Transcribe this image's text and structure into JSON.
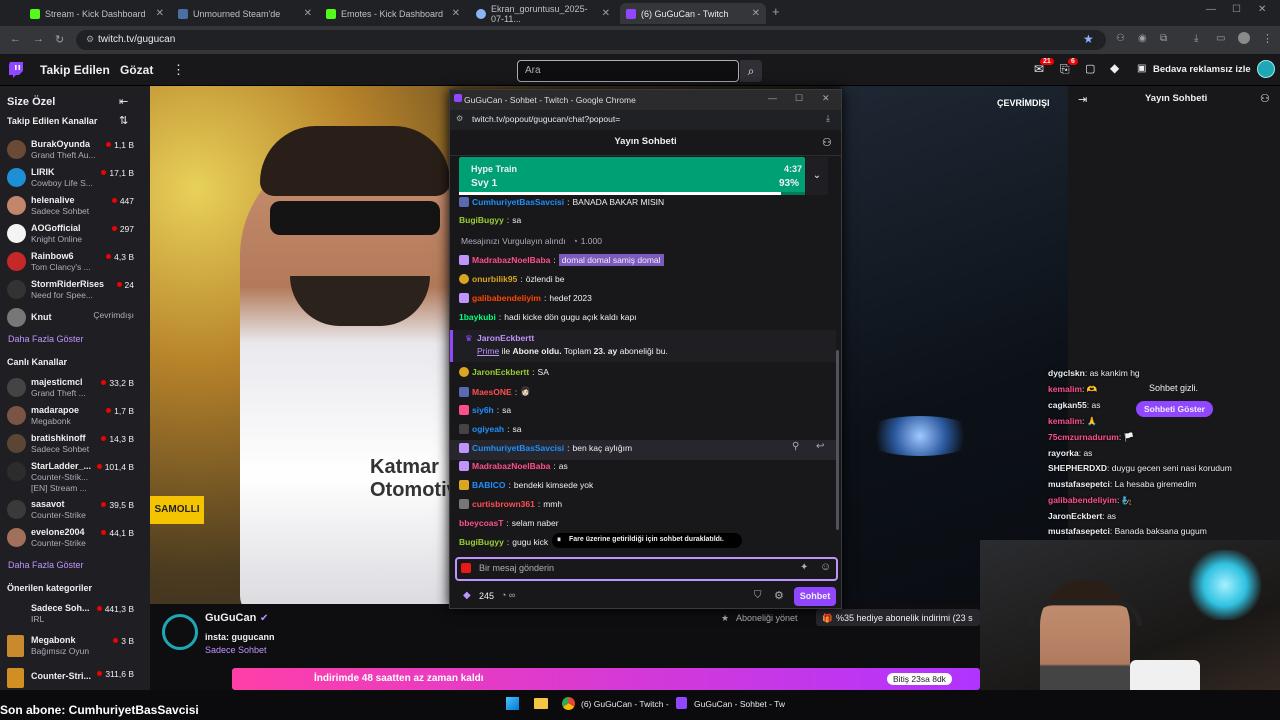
{
  "browser": {
    "tabs": [
      {
        "label": "Stream - Kick Dashboard",
        "fav": "#53fc18"
      },
      {
        "label": "Unmourned Steam'de",
        "fav": "#1b2838"
      },
      {
        "label": "Emotes - Kick Dashboard",
        "fav": "#53fc18"
      },
      {
        "label": "Ekran_goruntusu_2025-07-11...",
        "fav": "#8ab4f8"
      },
      {
        "label": "(6) GuGuCan - Twitch",
        "fav": "#9147ff"
      }
    ],
    "url": "twitch.tv/gugucan"
  },
  "nav": {
    "following": "Takip Edilen",
    "browse": "Gözat",
    "search_placeholder": "Ara",
    "notif_count": "21",
    "inbox_count": "6",
    "ad_free": "Bedava reklamsız izle"
  },
  "sidebar": {
    "title": "Size Özel",
    "followed_header": "Takip Edilen Kanallar",
    "followed": [
      {
        "name": "BurakOyunda",
        "game": "Grand Theft Au...",
        "viewers": "1,1 B",
        "color": "#6b4a35"
      },
      {
        "name": "LIRIK",
        "game": "Cowboy Life S...",
        "viewers": "17,1 B",
        "color": "#1d8fd6"
      },
      {
        "name": "helenalive",
        "game": "Sadece Sohbet",
        "viewers": "447",
        "color": "#c2866a"
      },
      {
        "name": "AOGofficial",
        "game": "Knight Online",
        "viewers": "297",
        "color": "#f4f4f4"
      },
      {
        "name": "Rainbow6",
        "game": "Tom Clancy's ...",
        "viewers": "4,3 B",
        "color": "#c62828"
      },
      {
        "name": "StormRiderRises",
        "game": "Need for Spee...",
        "viewers": "24",
        "color": "#333"
      },
      {
        "name": "Knut",
        "game": "",
        "viewers": "",
        "offline": "Çevrimdışı",
        "color": "#777"
      }
    ],
    "show_more": "Daha Fazla Göster",
    "live_header": "Canlı Kanallar",
    "live": [
      {
        "name": "majesticmcl",
        "game": "Grand Theft ...",
        "viewers": "33,2 B",
        "color": "#444"
      },
      {
        "name": "madarapoe",
        "game": "Megabonk",
        "viewers": "1,7 B",
        "color": "#7b5544"
      },
      {
        "name": "bratishkinoff",
        "game": "Sadece Sohbet",
        "viewers": "14,3 B",
        "color": "#5b4636"
      },
      {
        "name": "StarLadder_...",
        "game": "Counter-Strik...",
        "game2": "[EN] Stream ...",
        "viewers": "101,4 B",
        "color": "#2c2c2c"
      },
      {
        "name": "sasavot",
        "game": "Counter-Strike",
        "viewers": "39,5 B",
        "color": "#3a3a3a"
      },
      {
        "name": "evelone2004",
        "game": "Counter-Strike",
        "viewers": "44,1 B",
        "color": "#a0705a"
      }
    ],
    "show_more2": "Daha Fazla Göster",
    "cat_header": "Önerilen kategoriler",
    "categories": [
      {
        "name": "Sadece Soh...",
        "game": "IRL",
        "viewers": "441,3 B",
        "color": "#5a6ab0"
      },
      {
        "name": "Megabonk",
        "game": "Bağımsız Oyun",
        "viewers": "3 B",
        "color": "#c98a2e"
      },
      {
        "name": "Counter-Stri...",
        "game": "",
        "viewers": "311,6 B",
        "color": "#d18e22"
      }
    ]
  },
  "stream": {
    "offline_label": "ÇEVRİMDIŞI",
    "channel": "GuGuCan",
    "insta": "insta: gugucann",
    "category": "Sadece Sohbet",
    "manage_subs": "Aboneliği yönet",
    "sub_discount": "%35 hediye abonelik indirimi (23 s",
    "banner": "İndirimde 48 saatten az zaman kaldı",
    "banner_right": "Bitiş 23sa 8dk",
    "last_sub": "Son abone: CumhuriyetBasSavcisi"
  },
  "popup": {
    "window_title": "GuGuCan - Sohbet - Twitch - Google Chrome",
    "url": "twitch.tv/popout/gugucan/chat?popout=",
    "header": "Yayın Sohbeti",
    "hype_title": "Hype Train",
    "hype_level": "Svy 1",
    "hype_time": "4:37",
    "hype_pct": "93%",
    "hype_progress": 0.93,
    "messages": [
      {
        "user": "CumhuriyetBasSavcisi",
        "color": "#1e90ff",
        "text": "BANADA BAKAR MISIN",
        "badge": "#5a6ab0"
      },
      {
        "user": "BugiBugyy",
        "color": "#9acd32",
        "text": "sa"
      },
      {
        "system": "Mesajınızı Vurgulayın alındı",
        "amount": "1.000"
      },
      {
        "user": "MadrabazNoelBaba",
        "color": "#ff4f8b",
        "text": "domal domal samiş domal",
        "badge": "#bf94ff",
        "highlight": true
      },
      {
        "user": "onurbilik95",
        "color": "#daa520",
        "text": "özlendi be",
        "badge": "#daa520"
      },
      {
        "user": "galibabendeliyim",
        "color": "#ff4500",
        "text": "hedef 2023",
        "badge": "#bf94ff"
      },
      {
        "user": "1baykubi",
        "color": "#00ff7f",
        "text": "hadi kicke dön gugu açık kaldı kapı"
      },
      {
        "sub_user": "JaronEckbertt",
        "sub_line1": "Prime",
        "sub_line2": "ile",
        "sub_bold": "Abone oldu.",
        "sub_rest": "Toplam",
        "sub_months": "23. ay",
        "sub_tail": "aboneliği bu."
      },
      {
        "user": "JaronEckbertt",
        "color": "#9acd32",
        "text": "SA",
        "badge": "#daa520"
      },
      {
        "user": "MaesONE",
        "color": "#ff4f4f",
        "text": "👩🏻",
        "badge": "#5a6ab0"
      },
      {
        "user": "siy6h",
        "color": "#1e90ff",
        "text": "sa",
        "badge": "#ff4f8b"
      },
      {
        "user": "ogiyeah",
        "color": "#1e90ff",
        "text": "sa",
        "badge": "#444"
      },
      {
        "user": "CumhuriyetBasSavcisi",
        "color": "#1e90ff",
        "text": "ben kaç aylığım",
        "badge": "#bf94ff"
      },
      {
        "user": "MadrabazNoelBaba",
        "color": "#ff4f8b",
        "text": "as",
        "badge": "#bf94ff"
      },
      {
        "user": "BABICO",
        "color": "#1e90ff",
        "text": "bendeki kimsede yok",
        "badge": "#daa520"
      },
      {
        "user": "curtisbrown361",
        "color": "#ff4f4f",
        "text": "mmh",
        "badge": "#777"
      },
      {
        "user": "bbeycoasT",
        "color": "#ff4f8b",
        "text": "selam naber"
      },
      {
        "user": "BugiBugyy",
        "color": "#9acd32",
        "text": "gugu kick"
      }
    ],
    "paused": "Fare üzerine getirildiği için sohbet duraklatıldı.",
    "input_placeholder": "Bir mesaj gönderin",
    "points": "245",
    "chat_button": "Sohbet"
  },
  "right_chat": {
    "header": "Yayın Sohbeti",
    "hidden": "Sohbet gizli.",
    "show_button": "Sohbeti Göster",
    "messages": [
      {
        "user": "dygclskn",
        "text": ": as kankim hg",
        "color": "#efeff1"
      },
      {
        "user": "kemalim",
        "text": ": 🫶",
        "color": "#ff4f8b"
      },
      {
        "user": "cagkan55",
        "text": ": as",
        "color": "#efeff1"
      },
      {
        "user": "kemalim",
        "text": ": 🙏",
        "color": "#ff4f8b"
      },
      {
        "user": "75cmzurnadurum",
        "text": ": 🏳️",
        "color": "#ff4f8b"
      },
      {
        "user": "rayorka",
        "text": ": as",
        "color": "#efeff1"
      },
      {
        "user": "SHEPHERDXD",
        "text": ": duygu gecen seni nasi korudum",
        "color": "#efeff1"
      },
      {
        "user": "mustafasepetci",
        "text": ": La hesaba giremedim",
        "color": "#efeff1"
      },
      {
        "user": "galibabendeliyim",
        "text": ": 🧞",
        "color": "#ff4f8b"
      },
      {
        "user": "JaronEckbert",
        "text": ": as",
        "color": "#efeff1"
      },
      {
        "user": "mustafasepetci",
        "text": ": Banada baksana gugum",
        "color": "#efeff1"
      }
    ]
  },
  "taskbar": {
    "item1": "(6) GuGuCan - Twitch -",
    "item2": "GuGuCan - Sohbet - Tw"
  }
}
